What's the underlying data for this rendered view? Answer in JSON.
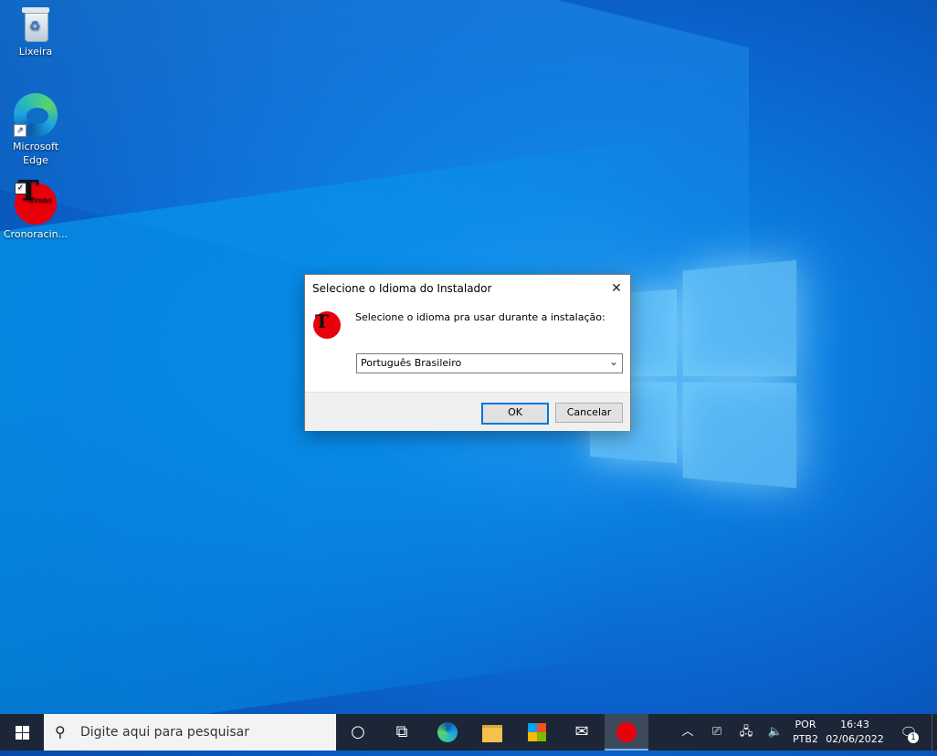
{
  "desktop": {
    "icons": [
      {
        "label": "Lixeira"
      },
      {
        "label": "Microsoft Edge"
      },
      {
        "label": "Cronoracin..."
      }
    ]
  },
  "dialog": {
    "title": "Selecione o Idioma do Instalador",
    "close_glyph": "✕",
    "prompt": "Selecione o idioma pra usar durante a instalação:",
    "language_select": {
      "selected": "Português Brasileiro"
    },
    "ok_label": "OK",
    "cancel_label": "Cancelar"
  },
  "taskbar": {
    "search_placeholder": "Digite aqui para pesquisar",
    "language": {
      "line1": "POR",
      "line2": "PTB2"
    },
    "clock": {
      "time": "16:43",
      "date": "02/06/2022"
    },
    "notification_count": "1"
  },
  "colors": {
    "taskbar_bg": "#1c2636",
    "accent": "#0078d7",
    "app_logo_red": "#e8000b"
  }
}
